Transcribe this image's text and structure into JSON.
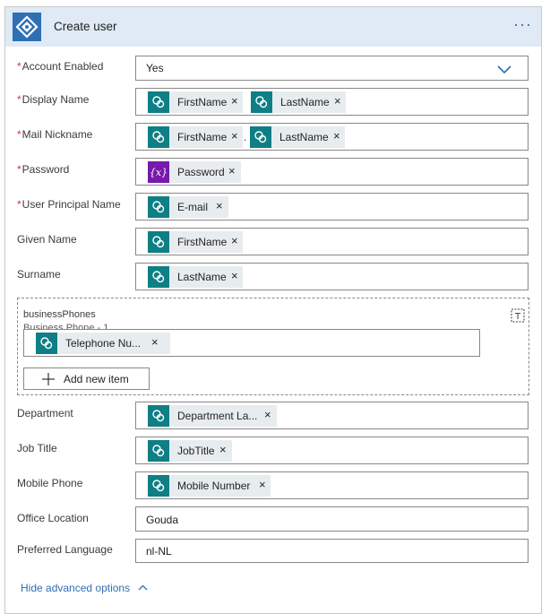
{
  "header": {
    "title": "Create user",
    "more_label": "···"
  },
  "fields": {
    "account_enabled": {
      "label": "Account Enabled",
      "value": "Yes"
    },
    "display_name": {
      "label": "Display Name",
      "tokens": [
        "FirstName",
        "LastName"
      ]
    },
    "mail_nickname": {
      "label": "Mail Nickname",
      "tokens": [
        "FirstName",
        "LastName"
      ],
      "separator": "."
    },
    "password": {
      "label": "Password",
      "tokens": [
        "Password"
      ]
    },
    "upn": {
      "label": "User Principal Name",
      "tokens": [
        "E-mail"
      ]
    },
    "given_name": {
      "label": "Given Name",
      "tokens": [
        "FirstName"
      ]
    },
    "surname": {
      "label": "Surname",
      "tokens": [
        "LastName"
      ]
    },
    "business_phones": {
      "label": "businessPhones",
      "item_label": "Business Phone - 1",
      "tokens": [
        "Telephone Nu..."
      ],
      "add_label": "Add new item"
    },
    "department": {
      "label": "Department",
      "tokens": [
        "Department La..."
      ]
    },
    "job_title": {
      "label": "Job Title",
      "tokens": [
        "JobTitle"
      ]
    },
    "mobile_phone": {
      "label": "Mobile Phone",
      "tokens": [
        "Mobile Number"
      ]
    },
    "office_location": {
      "label": "Office Location",
      "value": "Gouda"
    },
    "preferred_language": {
      "label": "Preferred Language",
      "value": "nl-NL"
    }
  },
  "footer": {
    "hide_advanced_label": "Hide advanced options"
  },
  "required_marker": "*",
  "remove_glyph": "×",
  "colors": {
    "accent": "#2f6fb4",
    "header_bg": "#dfeaf6",
    "sharepoint_token": "#0e7f84",
    "variable_token": "#7719aa",
    "token_bg": "#e7ecef",
    "required": "#d13438"
  }
}
